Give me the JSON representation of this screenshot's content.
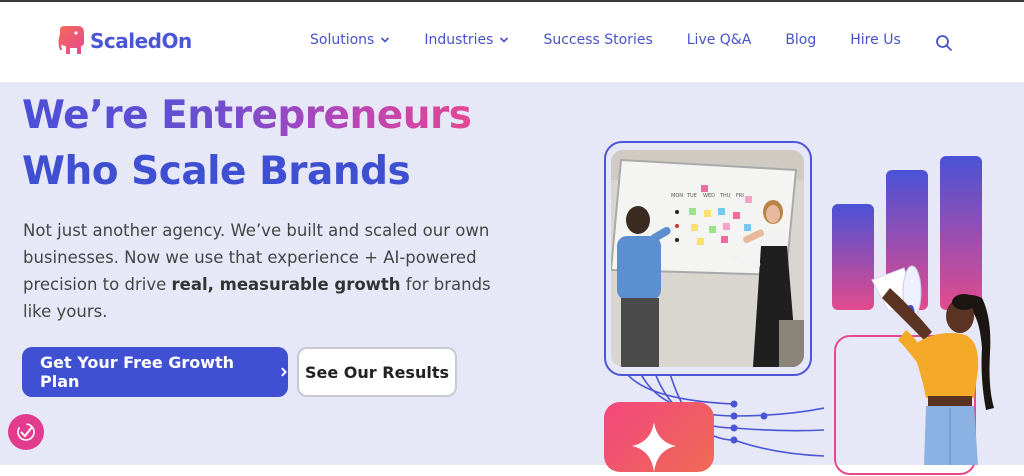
{
  "header": {
    "logo_text": "ScaledOn",
    "nav": [
      {
        "label": "Solutions",
        "has_dropdown": true
      },
      {
        "label": "Industries",
        "has_dropdown": true
      },
      {
        "label": "Success Stories",
        "has_dropdown": false
      },
      {
        "label": "Live Q&A",
        "has_dropdown": false
      },
      {
        "label": "Blog",
        "has_dropdown": false
      },
      {
        "label": "Hire Us",
        "has_dropdown": false
      }
    ],
    "search_icon": "search-icon"
  },
  "hero": {
    "title_line1": "We’re Entrepreneurs",
    "title_line2": "Who Scale Brands",
    "desc_part1": "Not just another agency. We’ve built and scaled our own businesses. Now we use that experience + AI-powered precision to drive ",
    "desc_bold": "real, measurable growth",
    "desc_part2": " for brands like yours.",
    "primary_cta": "Get Your Free Growth Plan",
    "secondary_cta": "See Our Results"
  },
  "whiteboard": {
    "days": [
      "MON",
      "TUE",
      "WED",
      "THU",
      "FRI"
    ]
  },
  "colors": {
    "brand_blue": "#4050d2",
    "brand_pink": "#e34b8d",
    "hero_bg": "#e7e8f7"
  }
}
